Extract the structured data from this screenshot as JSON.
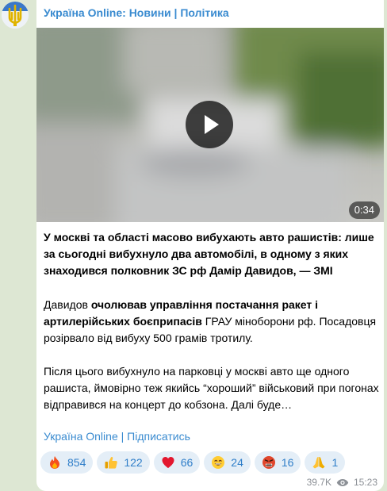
{
  "channel": {
    "title": "Україна Online: Новини | Політика"
  },
  "video": {
    "duration": "0:34",
    "play_icon": "play-icon"
  },
  "message": {
    "para1": "У москві та області масово вибухають авто рашистів: лише за сьогодні вибухнуло два автомобілі, в одному з яких знаходився полковник ЗС рф Дамір Давидов, — ЗМІ",
    "para2_a": "Давидов ",
    "para2_b": "очолював управління постачання ракет і артилерійських боєприпасів",
    "para2_c": " ГРАУ міноборони рф. Посадовця розірвало від вибуху 500 грамів тротилу.",
    "para3": "Після цього вибухнуло на парковці у москві авто ще одного рашиста, ймовірно теж якийсь “хороший” військовий при погонах відправився на концерт до кобзона. Далі буде…"
  },
  "footer": {
    "channel_link": "Україна Online",
    "separator": " | ",
    "subscribe_link": "Підписатись"
  },
  "reactions": [
    {
      "icon": "fire-icon",
      "count": "854"
    },
    {
      "icon": "thumbs-up-icon",
      "count": "122"
    },
    {
      "icon": "heart-icon",
      "count": "66"
    },
    {
      "icon": "grinning-face-icon",
      "count": "24"
    },
    {
      "icon": "angry-face-icon",
      "count": "16"
    },
    {
      "icon": "praying-hands-icon",
      "count": "1"
    }
  ],
  "meta": {
    "views": "39.7K",
    "views_icon": "eye-icon",
    "time": "15:23"
  },
  "colors": {
    "accent": "#3a8bd0",
    "background": "#dde7d3",
    "reaction_bg": "#e4eef7"
  }
}
